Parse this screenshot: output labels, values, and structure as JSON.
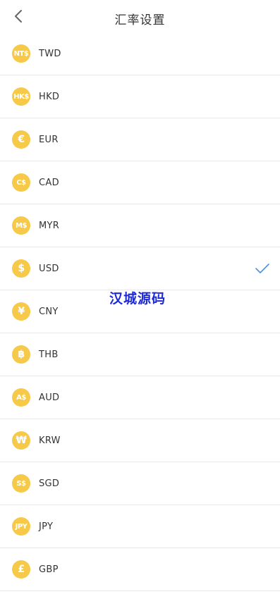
{
  "header": {
    "title": "汇率设置"
  },
  "currencies": [
    {
      "code": "TWD",
      "symbol": "NT$",
      "icon": "twd-coin-icon"
    },
    {
      "code": "HKD",
      "symbol": "HK$",
      "icon": "hkd-coin-icon"
    },
    {
      "code": "EUR",
      "symbol": "€",
      "icon": "eur-coin-icon"
    },
    {
      "code": "CAD",
      "symbol": "C$",
      "icon": "cad-coin-icon"
    },
    {
      "code": "MYR",
      "symbol": "M$",
      "icon": "myr-coin-icon"
    },
    {
      "code": "USD",
      "symbol": "$",
      "icon": "usd-coin-icon",
      "selected": true
    },
    {
      "code": "CNY",
      "symbol": "¥",
      "icon": "cny-coin-icon"
    },
    {
      "code": "THB",
      "symbol": "฿",
      "icon": "thb-coin-icon"
    },
    {
      "code": "AUD",
      "symbol": "A$",
      "icon": "aud-coin-icon"
    },
    {
      "code": "KRW",
      "symbol": "₩",
      "icon": "krw-coin-icon"
    },
    {
      "code": "SGD",
      "symbol": "S$",
      "icon": "sgd-coin-icon"
    },
    {
      "code": "JPY",
      "symbol": "JPY",
      "icon": "jpy-coin-icon"
    },
    {
      "code": "GBP",
      "symbol": "£",
      "icon": "gbp-coin-icon"
    }
  ],
  "watermark": "汉城源码",
  "colors": {
    "coin": "#f7c948",
    "check": "#4a90e2",
    "watermark": "#1e2ad8"
  }
}
